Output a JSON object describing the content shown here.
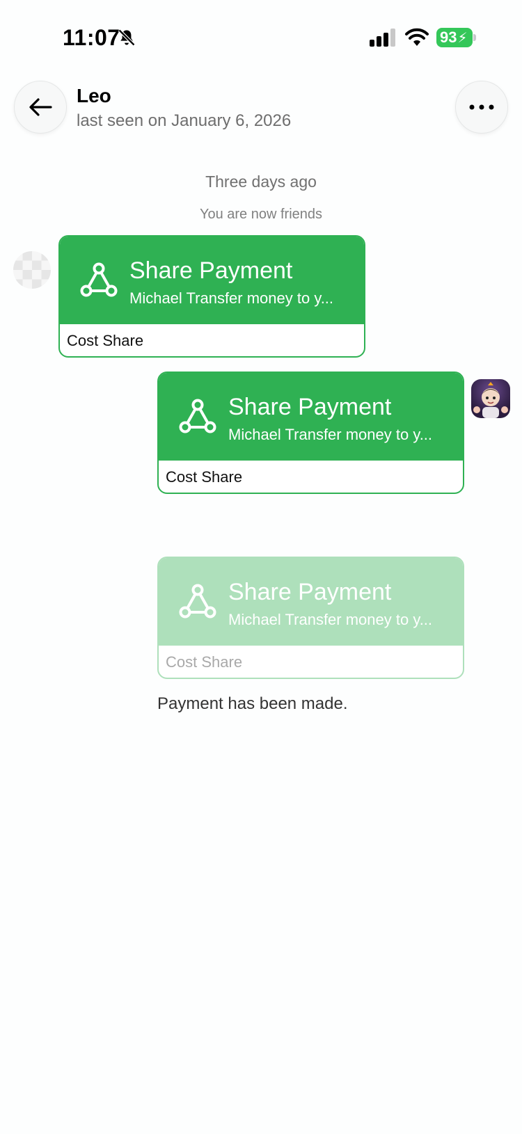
{
  "status_bar": {
    "time": "11:07",
    "battery": "93",
    "icons": [
      "bell-slash-icon",
      "signal-icon",
      "wifi-icon",
      "battery-icon"
    ]
  },
  "header": {
    "contact_name": "Leo",
    "last_seen": "last seen on January 6, 2026",
    "icons": [
      "arrow-left-icon",
      "more-dots-icon"
    ]
  },
  "chat": {
    "date_separator": "Three days ago",
    "friends_notice": "You are now friends",
    "messages": [
      {
        "title": "Share Payment",
        "subtitle": "Michael Transfer money to y...",
        "footer": "Cost Share",
        "side": "incoming",
        "state": "active"
      },
      {
        "title": "Share Payment",
        "subtitle": "Michael Transfer money to y...",
        "footer": "Cost Share",
        "side": "outgoing",
        "state": "active"
      },
      {
        "title": "Share Payment",
        "subtitle": "Michael Transfer money to y...",
        "footer": "Cost Share",
        "side": "outgoing",
        "state": "completed"
      }
    ],
    "payment_note": "Payment has been made."
  },
  "colors": {
    "accent_green": "#2fb153",
    "faded_green": "#aee0bb",
    "battery_green": "#34c759"
  }
}
